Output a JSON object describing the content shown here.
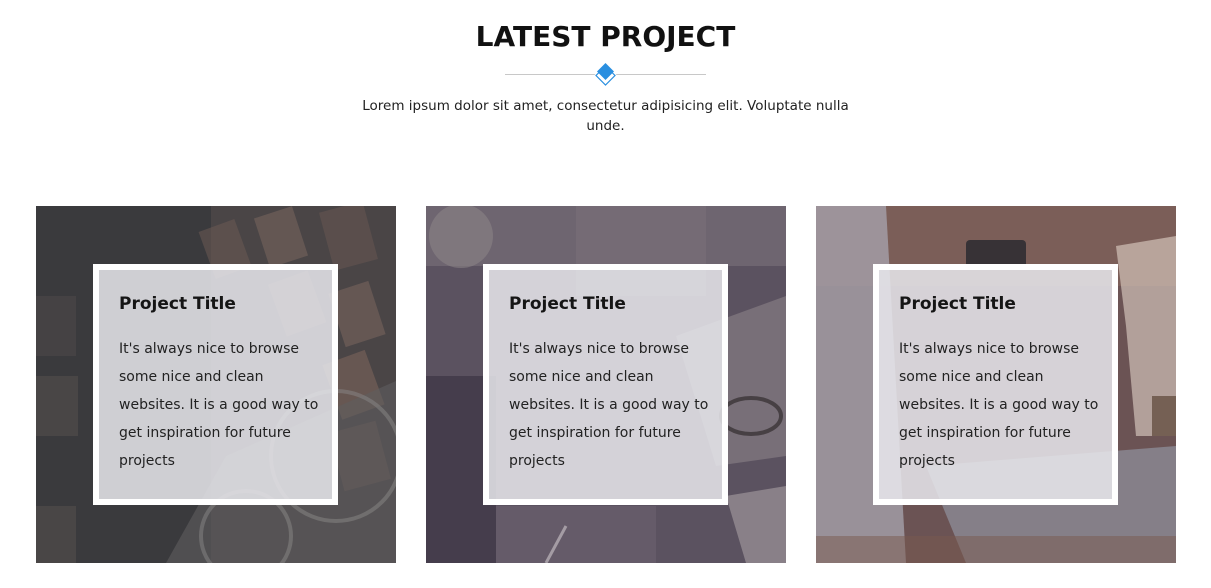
{
  "section": {
    "title": "LATEST PROJECT",
    "subtitle": "Lorem ipsum dolor sit amet, consectetur adipisicing elit. Voluptate nulla unde.",
    "accent_color": "#2a8fe0",
    "divider_icon": "diamond-icon"
  },
  "projects": [
    {
      "title": "Project Title",
      "description": "It's always nice to browse some nice and clean websites. It is a good way to get inspiration for future projects",
      "image": "stamps-and-magnifier-photo"
    },
    {
      "title": "Project Title",
      "description": "It's always nice to browse some nice and clean websites. It is a good way to get inspiration for future projects",
      "image": "desk-with-glasses-and-notebook-photo"
    },
    {
      "title": "Project Title",
      "description": "It's always nice to browse some nice and clean websites. It is a good way to get inspiration for future projects",
      "image": "laptop-and-coffee-photo"
    }
  ]
}
